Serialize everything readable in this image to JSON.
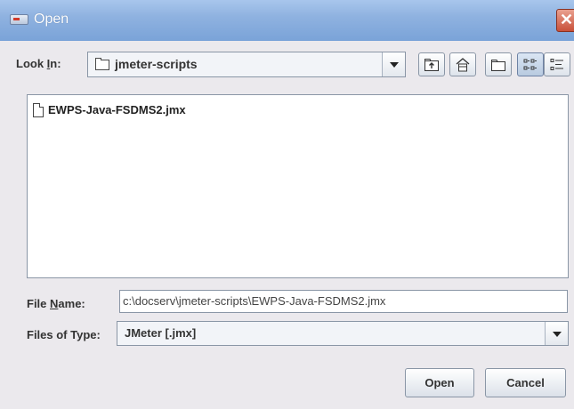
{
  "window": {
    "title": "Open",
    "close_glyph": "✕"
  },
  "look_in": {
    "label_prefix": "Look ",
    "label_mnemonic": "I",
    "label_suffix": "n:",
    "value": "jmeter-scripts"
  },
  "toolbar": {
    "icons": [
      "up-one-level-icon",
      "home-icon",
      "new-folder-icon",
      "list-view-icon",
      "details-view-icon"
    ]
  },
  "files": [
    {
      "name": "EWPS-Java-FSDMS2.jmx"
    }
  ],
  "file_name": {
    "label_prefix": "File ",
    "label_mnemonic": "N",
    "label_suffix": "ame:",
    "value": "c:\\docserv\\jmeter-scripts\\EWPS-Java-FSDMS2.jmx"
  },
  "files_of_type": {
    "label": "Files of Type:",
    "value": "JMeter [.jmx]"
  },
  "buttons": {
    "open": "Open",
    "cancel": "Cancel"
  },
  "colors": {
    "titlebar": "#8fb2e0",
    "background": "#ebe9ed",
    "close": "#c8503a"
  }
}
